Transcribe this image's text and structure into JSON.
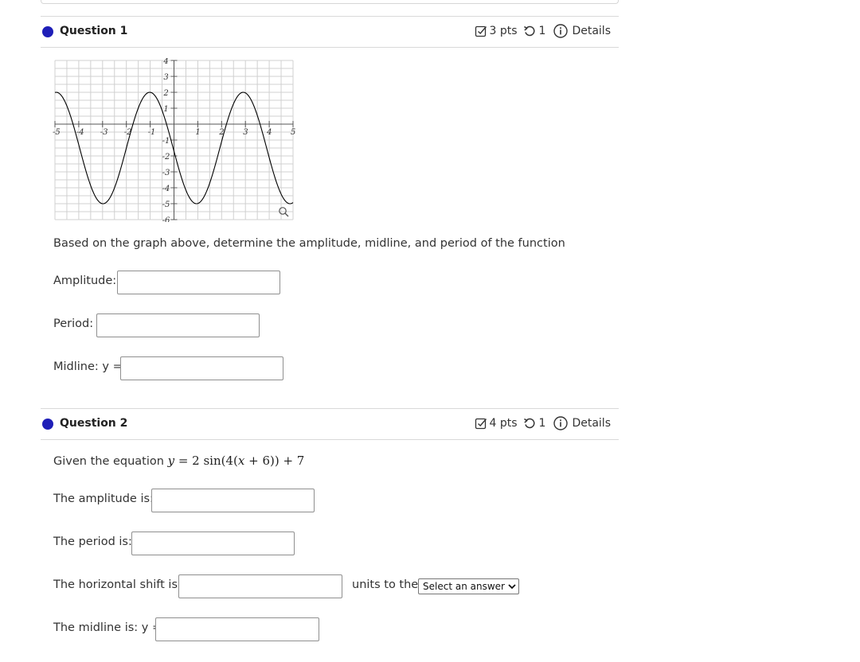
{
  "question1": {
    "title": "Question 1",
    "points": "3 pts",
    "attempts": "1",
    "details_label": "Details",
    "prompt": "Based on the graph above, determine the amplitude, midline, and period of the function",
    "amplitude_label": "Amplitude:",
    "period_label": "Period:",
    "midline_label": "Midline: y =",
    "amplitude_value": "",
    "period_value": "",
    "midline_value": ""
  },
  "graph": {
    "x_ticks": [
      "-5",
      "-4",
      "-3",
      "-2",
      "-1",
      "1",
      "2",
      "3",
      "4",
      "5"
    ],
    "y_ticks": [
      "4",
      "3",
      "2",
      "1",
      "-1",
      "-2",
      "-3",
      "-4",
      "-5",
      "-6"
    ],
    "xlim": [
      -5,
      5
    ],
    "ylim": [
      -6,
      4
    ],
    "function": "y = 3.5 sin(1.6(x + 2)) - 1.5",
    "zoom_icon": "magnifier-icon"
  },
  "question2": {
    "title": "Question 2",
    "points": "4 pts",
    "attempts": "1",
    "details_label": "Details",
    "prompt": "Given the equation",
    "equation_lhs": "y",
    "equation_eq": " = ",
    "equation_rhs_pre": "2 sin(4(",
    "equation_var": "x",
    "equation_rhs_post": " + 6)) + 7",
    "amplitude_label": "The amplitude is:",
    "period_label": "The period is:",
    "hshift_label": "The horizontal shift is:",
    "units_label": "units to the",
    "select_value": "Select an answer",
    "midline_label": "The midline is: y =",
    "amplitude_value": "",
    "period_value": "",
    "hshift_value": "",
    "midline_value": ""
  },
  "colors": {
    "bullet": "#1f1fb8",
    "grid": "#d0d0d0",
    "curve": "#000000"
  }
}
